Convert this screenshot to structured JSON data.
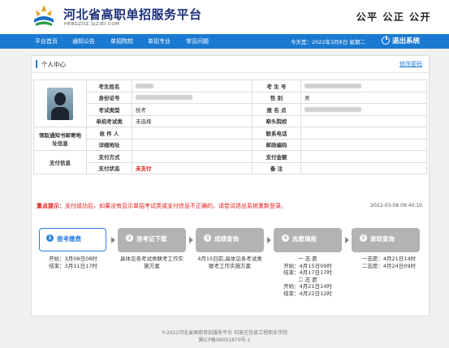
{
  "header": {
    "title": "河北省高职单招服务平台",
    "subtitle": "HEBGZDZ.SJZIEI.COM",
    "motto": "公平 公正 公开"
  },
  "nav": {
    "items": [
      "平台首页",
      "通知公告",
      "单招院校",
      "单招专业",
      "常见问题"
    ],
    "date": "今天是：2022年3月8日 星期二",
    "logout": "退出系统"
  },
  "panel": {
    "title": "个人中心",
    "edit_password": "修改密码"
  },
  "info": {
    "name_label": "考生姓名",
    "examno_label": "考 生 号",
    "id_label": "身份证号",
    "gender_label": "性 别",
    "gender": "男",
    "type_label": "考试类型",
    "type": "统考",
    "regno_label": "报 名 点",
    "category_label": "单招考试类",
    "category": "未选择",
    "lead_school_label": "牵头院校",
    "mail_group_label": "领取通知书邮寄地址信息",
    "recipient_label": "收 件 人",
    "phone_label": "联系电话",
    "address_label": "详细地址",
    "postcode_label": "邮政编码",
    "pay_group_label": "支付信息",
    "pay_method_label": "支付方式",
    "pay_amount_label": "支付金额",
    "pay_status_label": "支付状态",
    "pay_status": "未支付",
    "remark_label": "备 注"
  },
  "notice": {
    "label": "重点提示：",
    "text": "支付成功后，如果没有显示单招考试类或支付信息不正确的，请尝试退出系统重新登录。",
    "timestamp": "2022-03-08 09:40:10"
  },
  "steps": [
    {
      "num": "1",
      "label": "报考缴费",
      "active": true,
      "lines": [
        "开始：3月08日08时",
        "结束：3月11日17时"
      ]
    },
    {
      "num": "2",
      "label": "准考证下载",
      "active": false,
      "lines": [
        "具体见各考试类联考工作实",
        "施方案"
      ]
    },
    {
      "num": "3",
      "label": "成绩查询",
      "active": false,
      "lines": [
        "4月15日前,具体见各考试类",
        "联考工作实施方案"
      ]
    },
    {
      "num": "4",
      "label": "志愿填报",
      "active": false,
      "lines": [
        "一 志 愿",
        "开始：4月15日09时",
        "结束：4月17日17时",
        "二 志 愿",
        "开始：4月21日14时",
        "结束：4月22日12时"
      ]
    },
    {
      "num": "5",
      "label": "录取查询",
      "active": false,
      "lines": [
        "一志愿：4月21日14时",
        "二志愿：4月24日09时"
      ]
    }
  ],
  "footer": {
    "line1": "©2022河北省高职单招服务平台  石家庄信息工程职业学院",
    "line2": "冀ICP备06001870号-1"
  },
  "colors": {
    "nav_blue": "#1a7ad1",
    "title_navy": "#1a2e7a",
    "alert_red": "#e41818",
    "step_gray": "#b3b3b3",
    "step_active": "#2c7fe0"
  }
}
